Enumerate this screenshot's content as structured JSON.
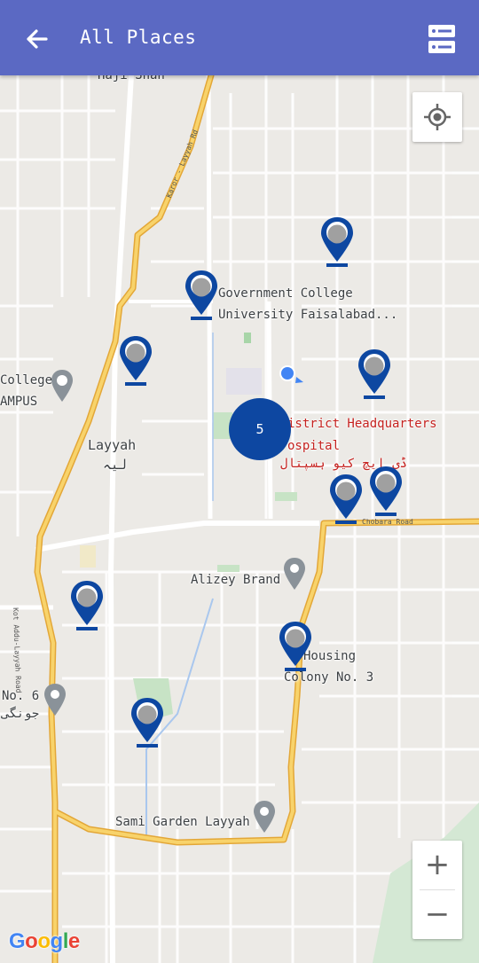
{
  "header": {
    "title": "All Places",
    "back_icon": "arrow-left-icon",
    "list_icon": "list-view-icon",
    "background": "#5b69c3"
  },
  "map": {
    "labels": {
      "top_cut": "Haji Shah",
      "gcu": "Government College",
      "gcu2": "University Faisalabad...",
      "college": "College",
      "campus": "AMPUS",
      "layyah": "Layyah",
      "layyah_urdu": "لیہ",
      "dhq": "istrict Headquarters",
      "dhq2": "ospital",
      "dhq_urdu": "ڈی ایچ کیو ہسپتال",
      "chobara": "Chobara Road",
      "alizey": "Alizey Brand",
      "housing": "Housing",
      "colony": "Colony No. 3",
      "no6": "No. 6",
      "urdu_left": "جونگی",
      "sami": "Sami Garden Layyah",
      "kotaddu": "Kot Addu-Layyah Road",
      "karor": "Karor - Layyah Rd"
    },
    "cluster_count": "5",
    "pin_color": "#0d47a1",
    "cluster_color": "#0d47a1",
    "road_color": "#f6c04c",
    "my_location_icon": "my-location-icon",
    "zoom_in": "+",
    "zoom_out": "−",
    "attribution": "Google"
  }
}
